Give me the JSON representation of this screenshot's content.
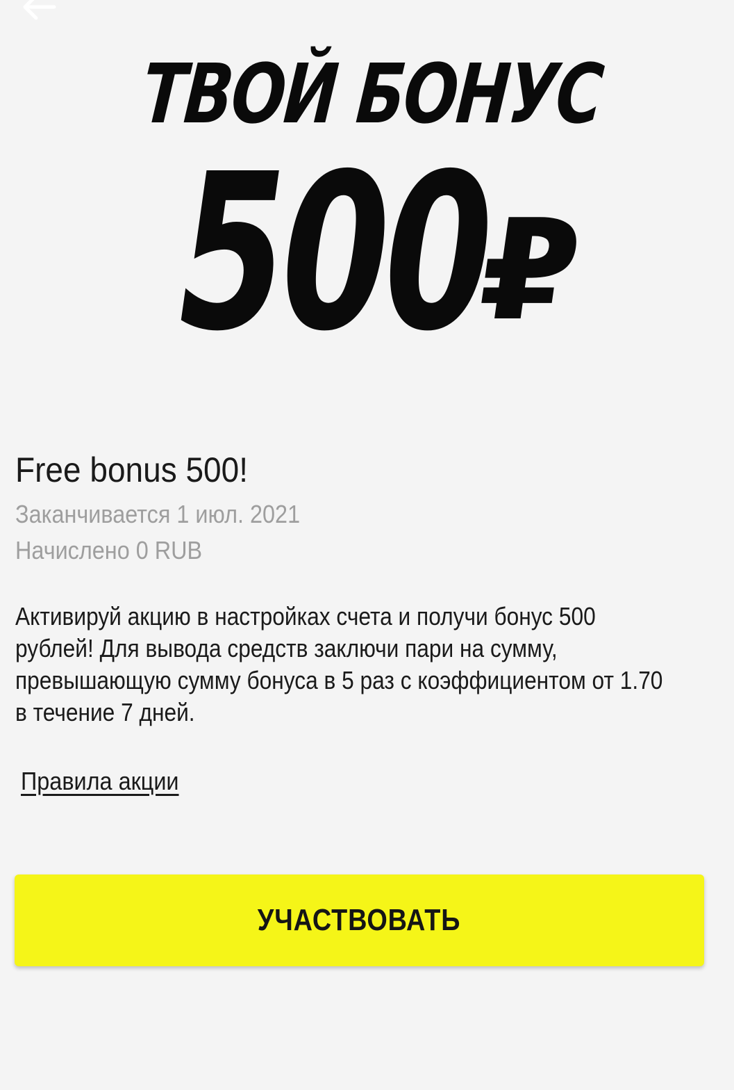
{
  "nav": {
    "back_icon": "arrow-left-icon"
  },
  "hero": {
    "headline": "ТВОЙ БОНУС",
    "amount": "500",
    "currency": "₽"
  },
  "promo": {
    "title": "Free bonus 500!",
    "expires": "Заканчивается 1 июл. 2021",
    "credited": "Начислено 0 RUB",
    "description": "Активируй акцию в настройках счета и получи бонус 500 рублей! Для вывода средств заключи пари на сумму, превышающую сумму бонуса в 5 раз с коэффициентом от 1.70 в течение 7 дней.",
    "rules_link": "Правила акции"
  },
  "cta": {
    "label": "УЧАСТВОВАТЬ"
  },
  "colors": {
    "background": "#f4f4f4",
    "accent": "#f5f518",
    "text": "#1a1a1a",
    "muted": "#9e9e9e"
  }
}
